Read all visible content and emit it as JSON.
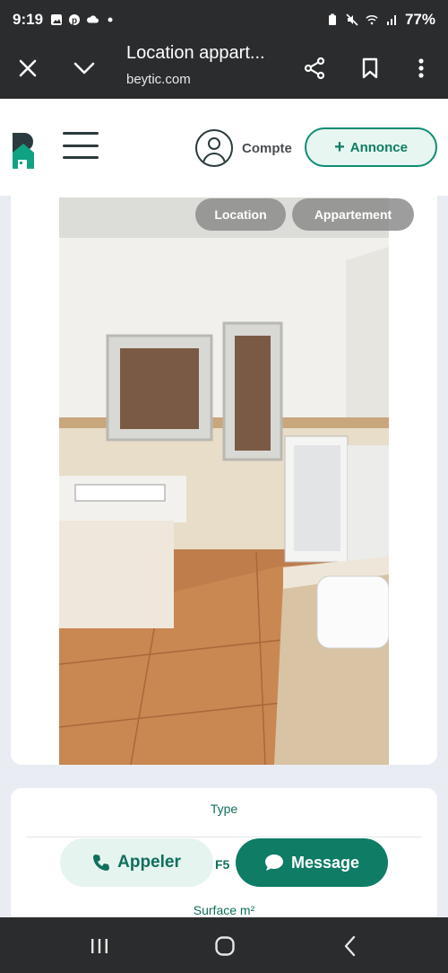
{
  "status_bar": {
    "time": "9:19",
    "battery": "77%",
    "icons": [
      "gallery-icon",
      "pinterest-icon",
      "cloud-icon",
      "dot-icon",
      "battery-saver-icon",
      "mute-icon",
      "wifi-icon",
      "signal-icon"
    ]
  },
  "browser": {
    "title": "Location appart...",
    "url": "beytic.com",
    "icons": [
      "close-icon",
      "chevron-down-icon",
      "share-icon",
      "bookmark-icon",
      "more-vert-icon"
    ]
  },
  "header": {
    "account_label": "Compte",
    "new_listing_label": "Annonce",
    "new_listing_plus": "+"
  },
  "listing": {
    "tags": [
      "Location",
      "Appartement"
    ],
    "type_label": "Type",
    "type_value": "F5",
    "surface_label": "Surface m²"
  },
  "actions": {
    "call_label": "Appeler",
    "message_label": "Message"
  },
  "colors": {
    "brand": "#0f7c66",
    "brand_light": "#e6f4f0",
    "chrome": "#2b2c2e"
  }
}
